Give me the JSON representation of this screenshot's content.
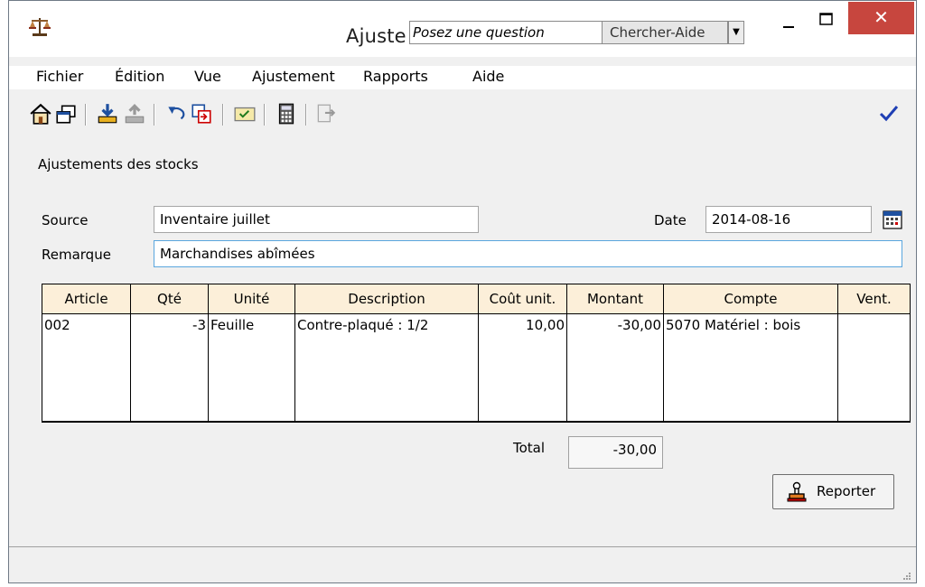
{
  "window": {
    "title": "Ajuste",
    "help_placeholder": "Posez une question",
    "help_button": "Chercher-Aide",
    "help_dropdown": "▼",
    "close_glyph": "✕"
  },
  "menu": [
    "Fichier",
    "Édition",
    "Vue",
    "Ajustement",
    "Rapports",
    "Aide"
  ],
  "form": {
    "heading": "Ajustements des stocks",
    "source_label": "Source",
    "source_value": "Inventaire juillet",
    "date_label": "Date",
    "date_value": "2014-08-16",
    "remark_label": "Remarque",
    "remark_value": "Marchandises abîmées"
  },
  "table": {
    "headers": [
      "Article",
      "Qté",
      "Unité",
      "Description",
      "Coût unit.",
      "Montant",
      "Compte",
      "Vent."
    ],
    "rows": [
      [
        "002",
        "-3",
        "Feuille",
        "Contre-plaqué : 1/2",
        "10,00",
        "-30,00",
        "5070 Matériel : bois",
        ""
      ]
    ]
  },
  "total": {
    "label": "Total",
    "value": "-30,00"
  },
  "post_button": {
    "label": "Reporter"
  },
  "colors": {
    "close_red": "#c7463e",
    "header_bg": "#fcefd9",
    "check_blue": "#1f3fb4"
  }
}
